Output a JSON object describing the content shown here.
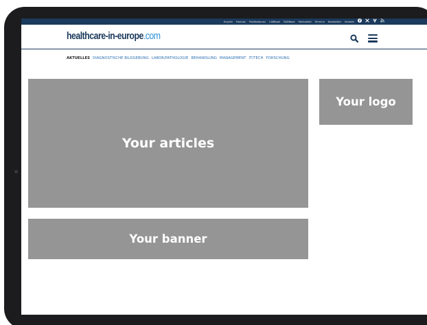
{
  "colors": {
    "brand": "#1b3a5c",
    "accent": "#2a8fd6",
    "placeholder": "#959595"
  },
  "utility_bar": {
    "links": [
      "English",
      "Podcast",
      "Publikationen",
      "LABBook",
      "RADBook",
      "Merkzettel",
      "Termine",
      "Newsletter",
      "Kontakt"
    ],
    "social_icons": [
      "facebook-icon",
      "x-icon",
      "pinterest-icon",
      "rss-icon"
    ]
  },
  "header": {
    "logo_main": "healthcare-in-europe",
    "logo_tld": ".com",
    "icons": [
      "search-icon",
      "hamburger-menu-icon"
    ]
  },
  "nav": {
    "items": [
      "AKTUELLES",
      "DIAGNOSTISCHE BILDGEBUNG",
      "LABOR/PATHOLOGIE",
      "BEHANDLUNG",
      "MANAGEMENT",
      "IT/TECH",
      "FORSCHUNG"
    ],
    "active_index": 0
  },
  "placeholders": {
    "articles": "Your articles",
    "logo": "Your logo",
    "banner": "Your banner"
  }
}
